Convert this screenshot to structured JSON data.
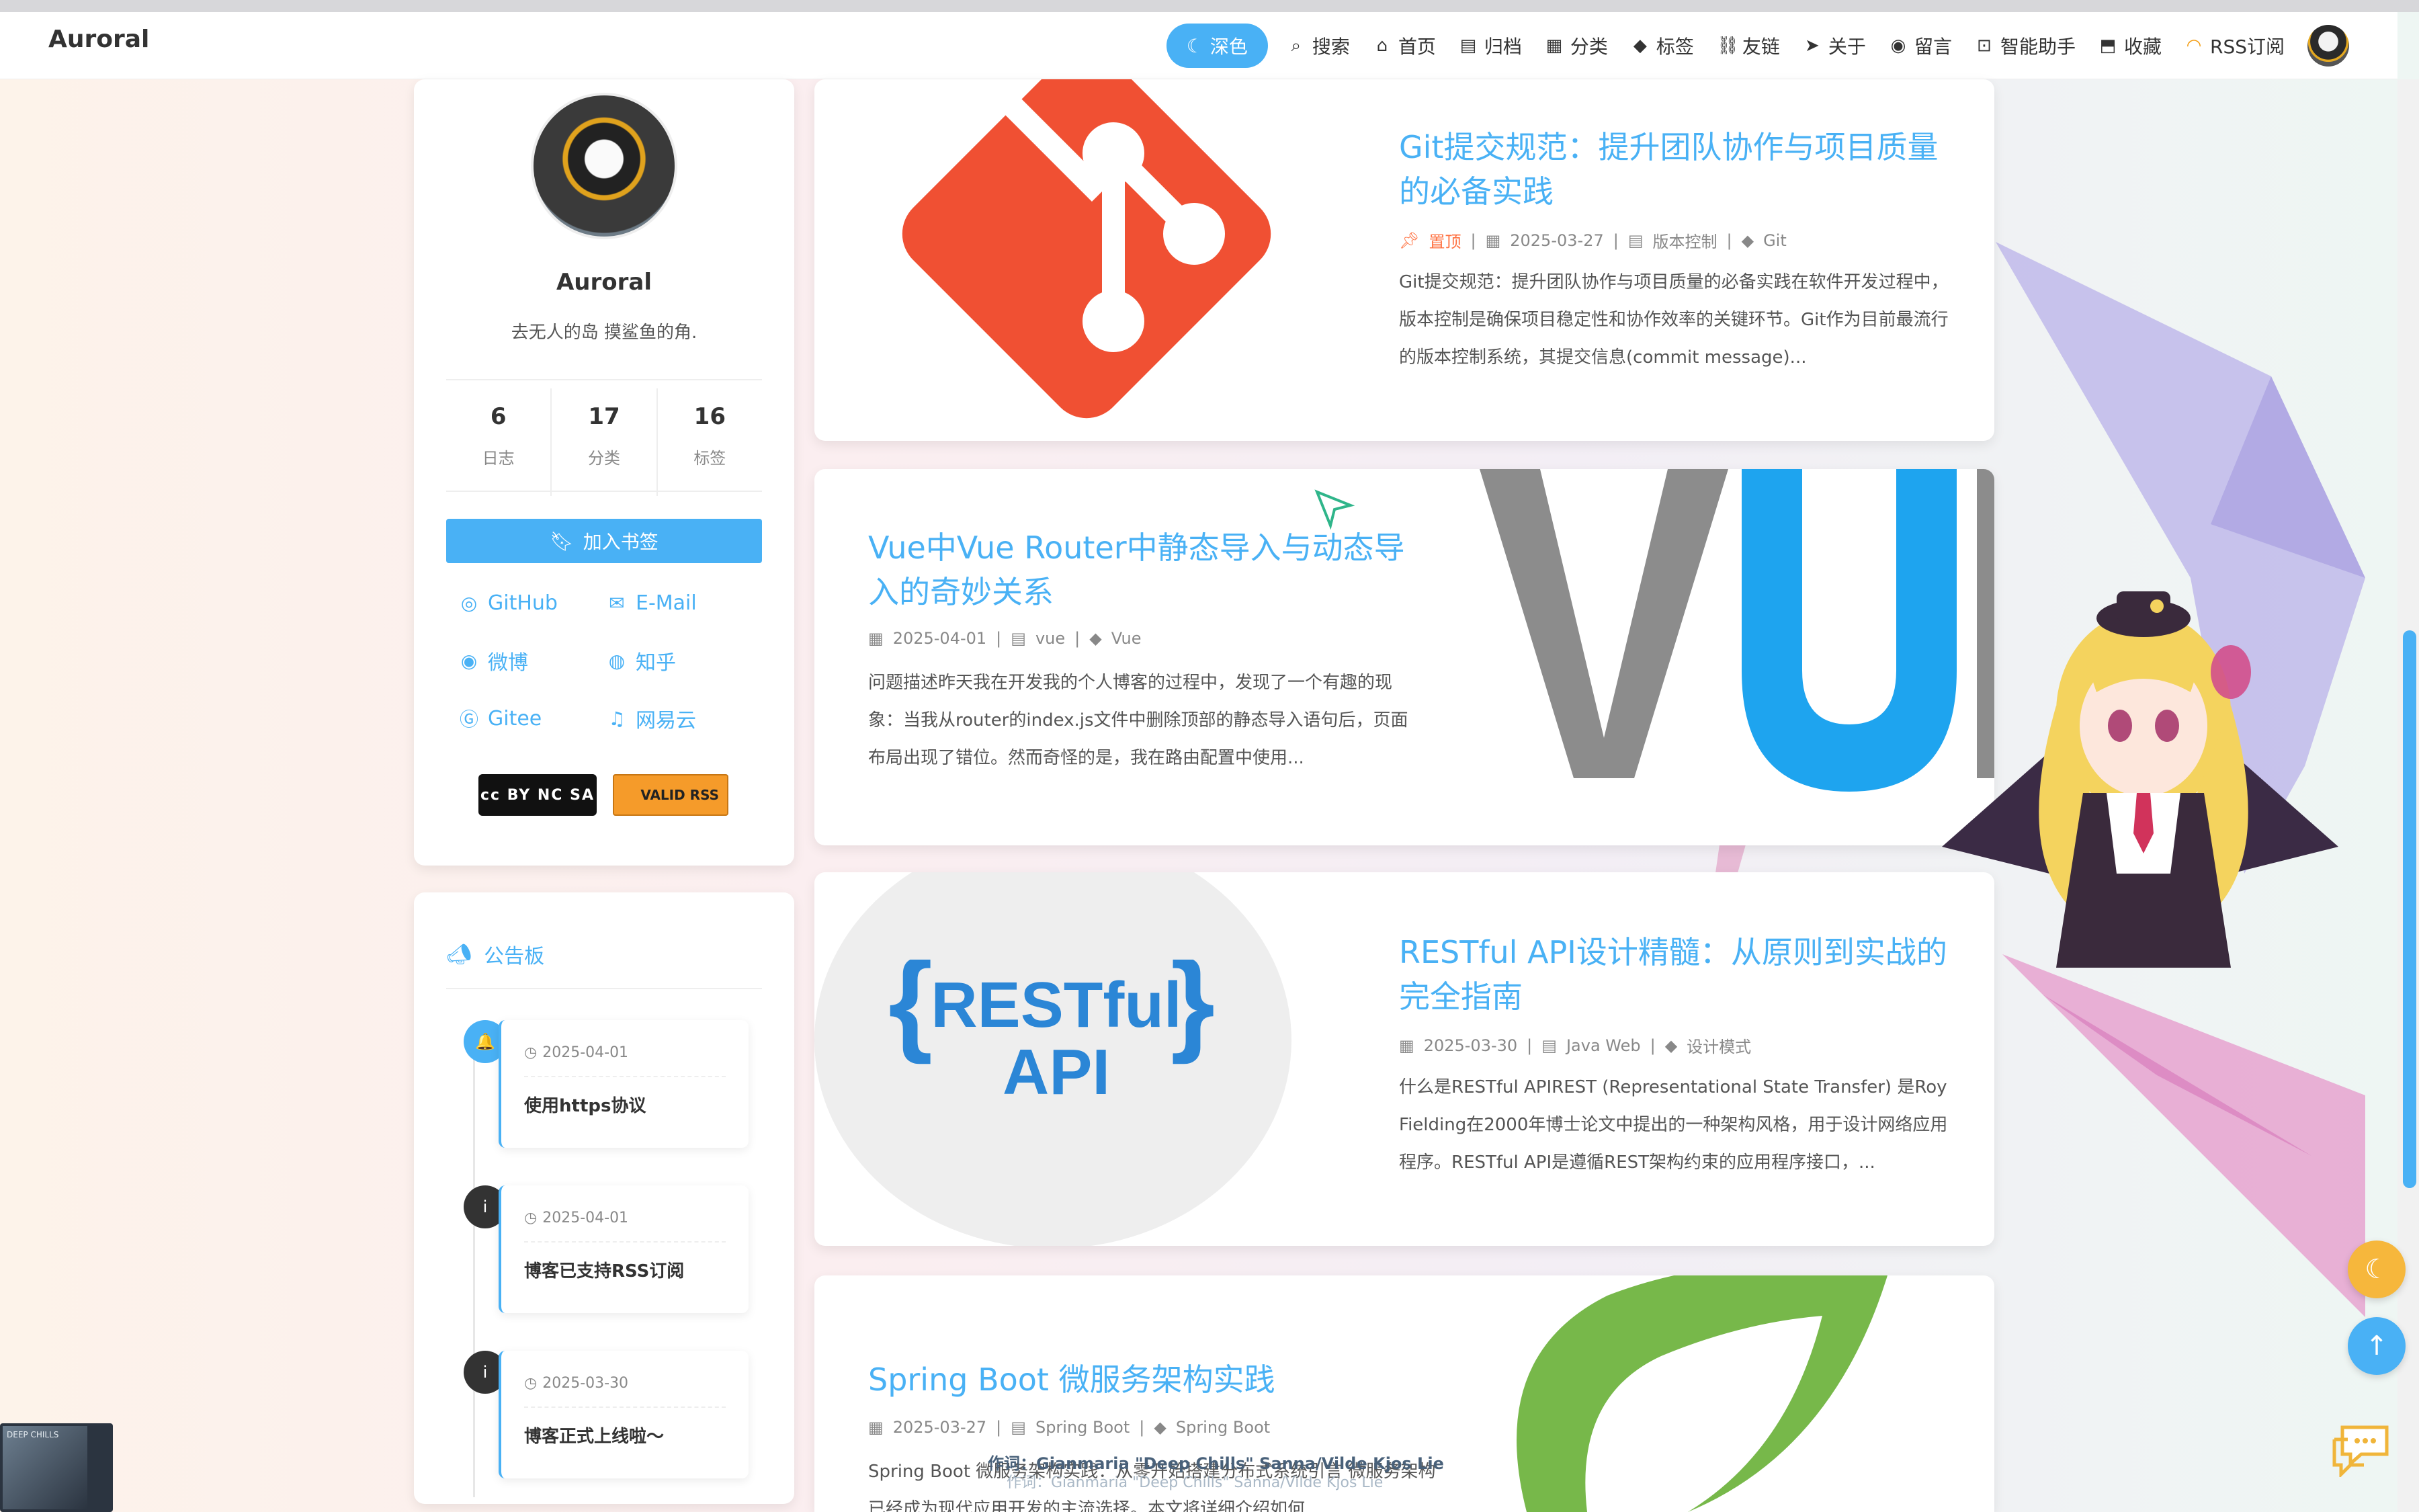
{
  "brand": "Auroral",
  "nav": {
    "theme_label": "深色",
    "items": [
      {
        "icon": "search-icon",
        "glyph": "⌕",
        "label": "搜索"
      },
      {
        "icon": "home-icon",
        "glyph": "⌂",
        "label": "首页"
      },
      {
        "icon": "archive-icon",
        "glyph": "▤",
        "label": "归档"
      },
      {
        "icon": "category-icon",
        "glyph": "▦",
        "label": "分类"
      },
      {
        "icon": "tag-icon",
        "glyph": "◆",
        "label": "标签"
      },
      {
        "icon": "link-icon",
        "glyph": "⛓",
        "label": "友链"
      },
      {
        "icon": "send-icon",
        "glyph": "➤",
        "label": "关于"
      },
      {
        "icon": "comment-icon",
        "glyph": "◉",
        "label": "留言"
      },
      {
        "icon": "robot-icon",
        "glyph": "⊡",
        "label": "智能助手"
      },
      {
        "icon": "bookmark-icon",
        "glyph": "⬒",
        "label": "收藏"
      },
      {
        "icon": "rss-icon",
        "glyph": "◠",
        "label": "RSS订阅"
      }
    ]
  },
  "profile": {
    "name": "Auroral",
    "description": "去无人的岛 摸鲨鱼的角.",
    "stats": [
      {
        "num": "6",
        "label": "日志"
      },
      {
        "num": "17",
        "label": "分类"
      },
      {
        "num": "16",
        "label": "标签"
      }
    ],
    "bookmark_label": "加入书签",
    "socials": [
      {
        "icon": "github-icon",
        "glyph": "◎",
        "label": "GitHub"
      },
      {
        "icon": "email-icon",
        "glyph": "✉",
        "label": "E-Mail"
      },
      {
        "icon": "weibo-icon",
        "glyph": "◉",
        "label": "微博"
      },
      {
        "icon": "zhihu-icon",
        "glyph": "◍",
        "label": "知乎"
      },
      {
        "icon": "gitee-icon",
        "glyph": "Ⓖ",
        "label": "Gitee"
      },
      {
        "icon": "netease-music-icon",
        "glyph": "♫",
        "label": "网易云"
      }
    ],
    "badge_cc": "cc BY NC SA",
    "badge_rss": "VALID RSS"
  },
  "notice": {
    "title": "公告板",
    "items": [
      {
        "date": "2025-04-01",
        "title": "使用https协议",
        "color": "#49b1f5",
        "glyph": "🔔"
      },
      {
        "date": "2025-04-01",
        "title": "博客已支持RSS订阅",
        "color": "#333333",
        "glyph": "i"
      },
      {
        "date": "2025-03-30",
        "title": "博客正式上线啦～",
        "color": "#333333",
        "glyph": "i"
      }
    ]
  },
  "posts": [
    {
      "title": "Git提交规范：提升团队协作与项目质量的必备实践",
      "pinned": "置顶",
      "date": "2025-03-27",
      "category": "版本控制",
      "tag": "Git",
      "excerpt": "Git提交规范：提升团队协作与项目质量的必备实践在软件开发过程中，版本控制是确保项目稳定性和协作效率的关键环节。Git作为目前最流行的版本控制系统，其提交信息(commit message)..."
    },
    {
      "title": "Vue中Vue Router中静态导入与动态导入的奇妙关系",
      "date": "2025-04-01",
      "category": "vue",
      "tag": "Vue",
      "excerpt": "问题描述昨天我在开发我的个人博客的过程中，发现了一个有趣的现象：当我从router的index.js文件中删除顶部的静态导入语句后，页面布局出现了错位。然而奇怪的是，我在路由配置中使用...",
      "cover_text": "VUE"
    },
    {
      "title": "RESTful API设计精髓：从原则到实战的完全指南",
      "date": "2025-03-30",
      "category": "Java Web",
      "tag": "设计模式",
      "excerpt": "什么是RESTful APIREST (Representational State Transfer) 是Roy Fielding在2000年博士论文中提出的一种架构风格，用于设计网络应用程序。RESTful API是遵循REST架构约束的应用程序接口，...",
      "cover_line1": "RESTful",
      "cover_line2": "API"
    },
    {
      "title": "Spring Boot 微服务架构实践",
      "date": "2025-03-27",
      "category": "Spring Boot",
      "tag": "Spring Boot",
      "excerpt": "Spring Boot 微服务架构实践：从零开始搭建分布式系统引言 微服务架构已经成为现代应用开发的主流选择。本文将详细介绍如何..."
    }
  ],
  "music": {
    "thumb_title": "DEEP CHILLS",
    "lyric": "作词：Gianmaria \"Deep Chills\" Sanna/Vilde Kjos Lie",
    "lyric_sub": "作词：Gianmaria \"Deep Chills\" Sanna/Vilde Kjos Lie"
  },
  "colors": {
    "accent": "#49b1f5",
    "pin": "#ff7242",
    "git": "#f05033",
    "vue_blue": "#1ea4ef",
    "spring": "#77b84a"
  }
}
